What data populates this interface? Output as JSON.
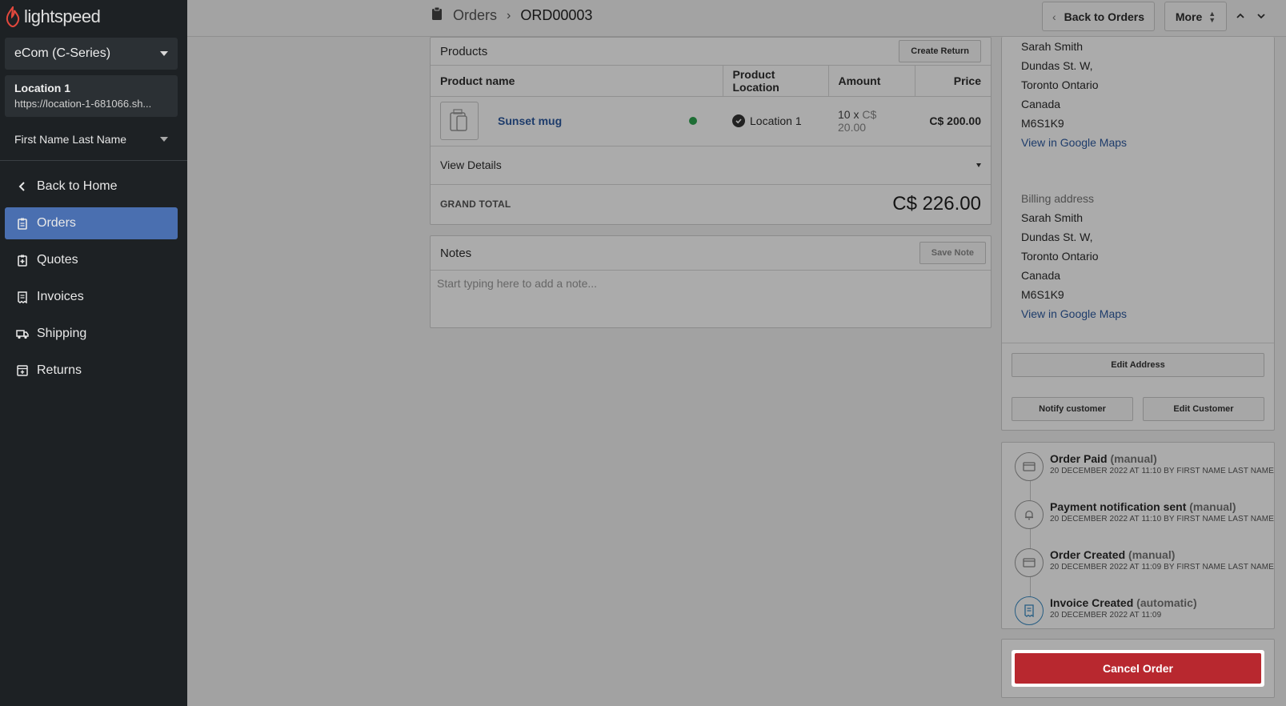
{
  "sidebar": {
    "logo_text": "lightspeed",
    "store": "eCom (C-Series)",
    "location_title": "Location 1",
    "location_url": "https://location-1-681066.sh...",
    "user": "First Name Last Name",
    "back_home": "Back to Home",
    "nav": [
      {
        "label": "Orders",
        "icon": "clipboard-icon",
        "active": true
      },
      {
        "label": "Quotes",
        "icon": "quote-icon"
      },
      {
        "label": "Invoices",
        "icon": "invoice-icon"
      },
      {
        "label": "Shipping",
        "icon": "truck-icon"
      },
      {
        "label": "Returns",
        "icon": "return-box-icon"
      }
    ]
  },
  "header": {
    "crumb_parent": "Orders",
    "crumb_current": "ORD00003",
    "back_to_orders": "Back to Orders",
    "more": "More"
  },
  "products": {
    "title": "Products",
    "create_return": "Create Return",
    "columns": [
      "Product name",
      "Product Location",
      "Amount",
      "Price"
    ],
    "row": {
      "name": "Sunset mug",
      "location": "Location 1",
      "qty": "10 x",
      "unit": "C$ 20.00",
      "price": "C$ 200.00"
    },
    "view_details": "View Details",
    "grand_total_label": "GRAND TOTAL",
    "grand_total_value": "C$ 226.00"
  },
  "notes": {
    "title": "Notes",
    "save": "Save Note",
    "placeholder": "Start typing here to add a note..."
  },
  "shipping_address": {
    "lines": [
      "Sarah Smith",
      "Dundas St. W,",
      "Toronto Ontario",
      "Canada",
      "M6S1K9"
    ],
    "maps_link": "View in Google Maps"
  },
  "billing_address": {
    "label": "Billing address",
    "lines": [
      "Sarah Smith",
      "Dundas St. W,",
      "Toronto Ontario",
      "Canada",
      "M6S1K9"
    ],
    "maps_link": "View in Google Maps"
  },
  "customer_actions": {
    "edit_address": "Edit Address",
    "notify": "Notify customer",
    "edit_customer": "Edit Customer"
  },
  "timeline": [
    {
      "title": "Order Paid",
      "mode": "(manual)",
      "sub": "20 DECEMBER 2022 AT 11:10 BY FIRST NAME LAST NAME"
    },
    {
      "title": "Payment notification sent",
      "mode": "(manual)",
      "sub": "20 DECEMBER 2022 AT 11:10 BY FIRST NAME LAST NAME"
    },
    {
      "title": "Order Created",
      "mode": "(manual)",
      "sub": "20 DECEMBER 2022 AT 11:09 BY FIRST NAME LAST NAME"
    },
    {
      "title": "Invoice Created",
      "mode": "(automatic)",
      "sub": "20 DECEMBER 2022 AT 11:09"
    }
  ],
  "cancel_order": "Cancel Order",
  "colors": {
    "sidebar_bg": "#1d2124",
    "nav_active": "#4a6fb0",
    "link": "#2d5aa0",
    "danger": "#b8282f",
    "paid_dot": "#2ea44f"
  }
}
